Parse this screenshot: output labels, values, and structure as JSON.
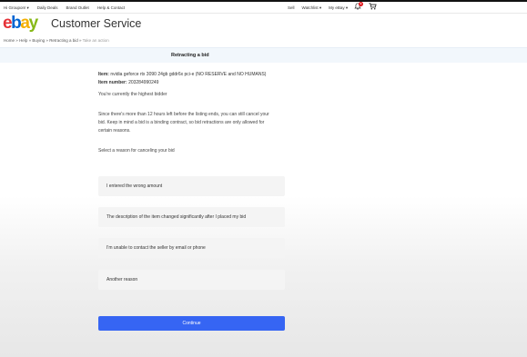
{
  "topbar": {
    "left_items": [
      "Hi Groupon! ▾",
      "Daily Deals",
      "Brand Outlet",
      "Help & Contact"
    ],
    "right_items": [
      "Sell",
      "Watchlist ▾",
      "My eBay ▾"
    ],
    "notification_count": "9"
  },
  "header": {
    "logo": {
      "e": "e",
      "b": "b",
      "a": "a",
      "y": "y"
    },
    "title": "Customer Service"
  },
  "breadcrumb": [
    "Home",
    "Help",
    "Buying",
    "Retracting a bid",
    "Take an action"
  ],
  "breadcrumb_separator": "»",
  "banner": {
    "title": "Retracting a bid"
  },
  "item": {
    "item_label": "Item:",
    "item_value": "nvidia geforce rtx 3090 24gb gddr6x pci-e (NO RESERVE and NO HUMANS)",
    "number_label": "Item number:",
    "number_value": "203284990249"
  },
  "status_text": "You're currently the highest bidder",
  "info_lines": [
    "Since there's more than 12 hours left before the listing ends, you can still cancel your",
    "bid. Keep in mind a bid is a binding contract, so bid retractions are only allowed for",
    "certain reasons."
  ],
  "prompt": "Select a reason for canceling your bid",
  "options": [
    {
      "label": "I entered the wrong amount"
    },
    {
      "label": "The description of the item changed significantly after I placed my bid"
    },
    {
      "label": "I'm unable to contact the seller by email or phone"
    },
    {
      "label": "Another reason"
    }
  ],
  "continue_label": "Continue",
  "colors": {
    "accent": "#3665f3",
    "banner_bg": "#f2f7fc",
    "option_bg": "#f4f4f4"
  }
}
